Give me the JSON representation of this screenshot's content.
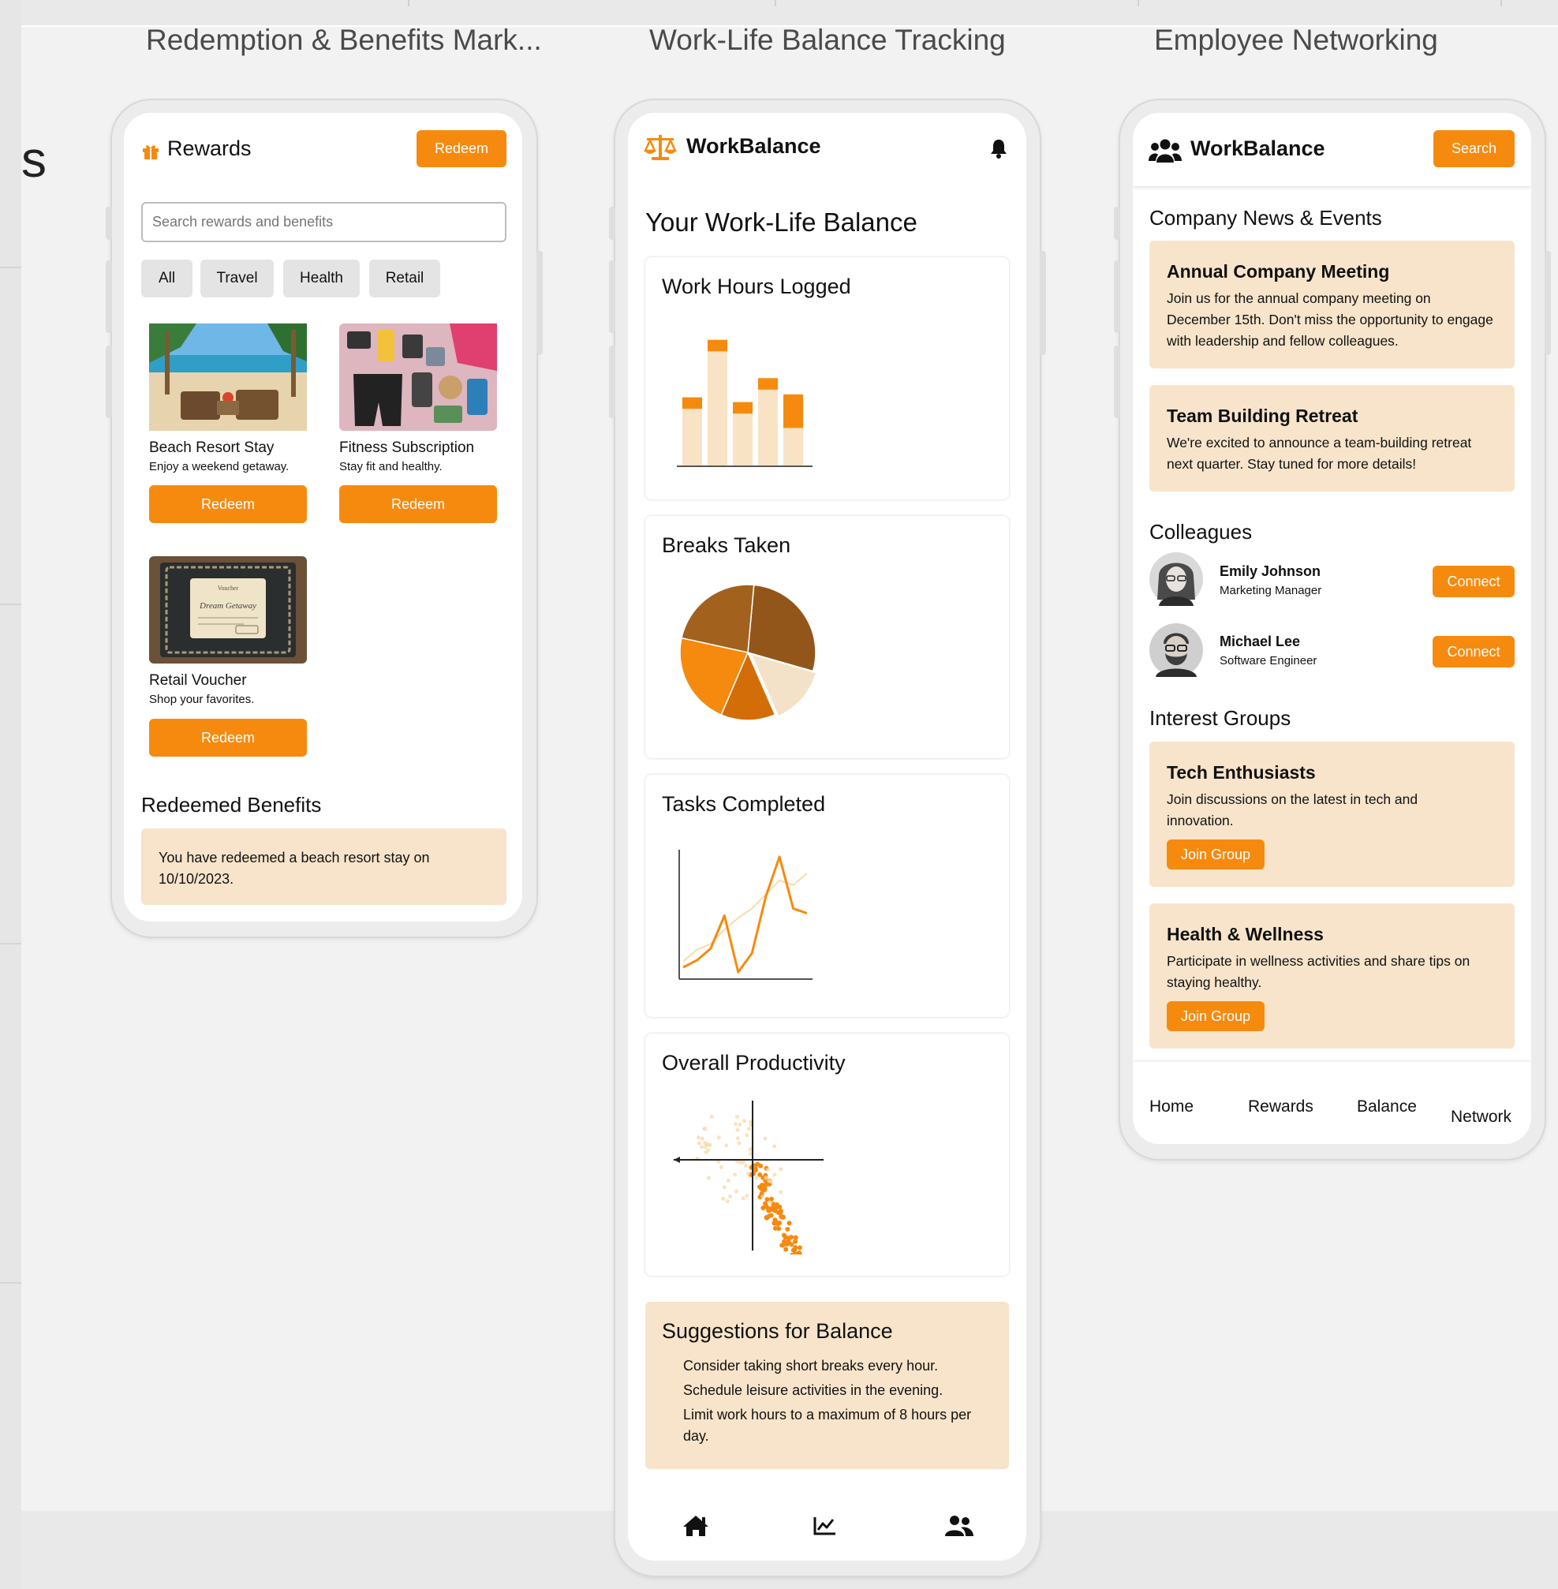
{
  "columns": {
    "rewards": "Redemption & Benefits Mark...",
    "balance": "Work-Life Balance Tracking",
    "network": "Employee Networking"
  },
  "edge_glyph": "s",
  "rewards": {
    "title": "Rewards",
    "header_button": "Redeem",
    "search_placeholder": "Search rewards and benefits",
    "filters": [
      "All",
      "Travel",
      "Health",
      "Retail"
    ],
    "items": [
      {
        "name": "Beach Resort Stay",
        "desc": "Enjoy a weekend getaway.",
        "button": "Redeem"
      },
      {
        "name": "Fitness Subscription",
        "desc": "Stay fit and healthy.",
        "button": "Redeem"
      },
      {
        "name": "Retail Voucher",
        "desc": "Shop your favorites.",
        "button": "Redeem"
      }
    ],
    "redeemed_title": "Redeemed Benefits",
    "redeemed_text": "You have redeemed a beach resort stay on 10/10/2023.",
    "voucher_header": "Voucher",
    "voucher_script": "Dream Getaway"
  },
  "balance": {
    "app_name": "WorkBalance",
    "heading": "Your Work-Life Balance",
    "cards": {
      "hours": "Work Hours Logged",
      "breaks": "Breaks Taken",
      "tasks": "Tasks Completed",
      "productivity": "Overall Productivity"
    },
    "suggestions_title": "Suggestions for Balance",
    "suggestions": [
      "Consider taking short breaks every hour.",
      "Schedule leisure activities in the evening.",
      "Limit work hours to a maximum of 8 hours per day."
    ],
    "nav_icons": [
      "home-icon",
      "chart-line-icon",
      "users-icon"
    ]
  },
  "chart_data": [
    {
      "type": "bar",
      "categories": [
        "1",
        "2",
        "3",
        "4",
        "5"
      ],
      "series": [
        {
          "values": [
            6,
            12,
            5.5,
            8,
            4
          ]
        },
        {
          "values": [
            1.2,
            1.2,
            1.2,
            1.2,
            3.5
          ]
        }
      ],
      "stacked": true,
      "ylim": [
        0,
        14
      ],
      "colors": [
        "#f68a0f",
        "#f9e3c5"
      ]
    },
    {
      "type": "pie",
      "values": [
        28,
        14,
        13,
        22,
        23
      ],
      "colors": [
        "#93561a",
        "#f4e2c8",
        "#d26d08",
        "#f68a0f",
        "#a2611d"
      ]
    },
    {
      "type": "line",
      "x": [
        0,
        1,
        2,
        3,
        4,
        5,
        6,
        7,
        8,
        9
      ],
      "series": [
        {
          "values": [
            1,
            1.6,
            2.6,
            5.4,
            0.6,
            2.2,
            7,
            10.4,
            6,
            5.6
          ]
        },
        {
          "values": [
            1.5,
            2.5,
            3,
            4.2,
            5.2,
            6,
            7.2,
            8.4,
            8,
            9
          ]
        }
      ],
      "ylim": [
        0,
        11
      ],
      "colors": [
        "#f68a0f",
        "#fbd9ab"
      ]
    },
    {
      "type": "scatter",
      "xlim": [
        -5,
        5
      ],
      "ylim": [
        -5,
        5
      ],
      "colors": [
        "#f68a0f",
        "#fbd9ab"
      ]
    }
  ],
  "network": {
    "app_name": "WorkBalance",
    "search_button": "Search",
    "news_title": "Company News & Events",
    "news": [
      {
        "title": "Annual Company Meeting",
        "body": "Join us for the annual company meeting on December 15th. Don't miss the opportunity to engage with leadership and fellow colleagues."
      },
      {
        "title": "Team Building Retreat",
        "body": "We're excited to announce a team-building retreat next quarter. Stay tuned for more details!"
      }
    ],
    "colleagues_title": "Colleagues",
    "colleagues": [
      {
        "name": "Emily Johnson",
        "role": "Marketing Manager",
        "button": "Connect"
      },
      {
        "name": "Michael Lee",
        "role": "Software Engineer",
        "button": "Connect"
      }
    ],
    "groups_title": "Interest Groups",
    "groups": [
      {
        "title": "Tech Enthusiasts",
        "body": "Join discussions on the latest in tech and innovation.",
        "button": "Join Group"
      },
      {
        "title": "Health & Wellness",
        "body": "Participate in wellness activities and share tips on staying healthy.",
        "button": "Join Group"
      }
    ],
    "nav": [
      "Home",
      "Rewards",
      "Balance",
      "Network"
    ]
  },
  "colors": {
    "accent": "#f68a0f",
    "peach": "#f7e4ca",
    "chip": "#e4e4e4"
  }
}
